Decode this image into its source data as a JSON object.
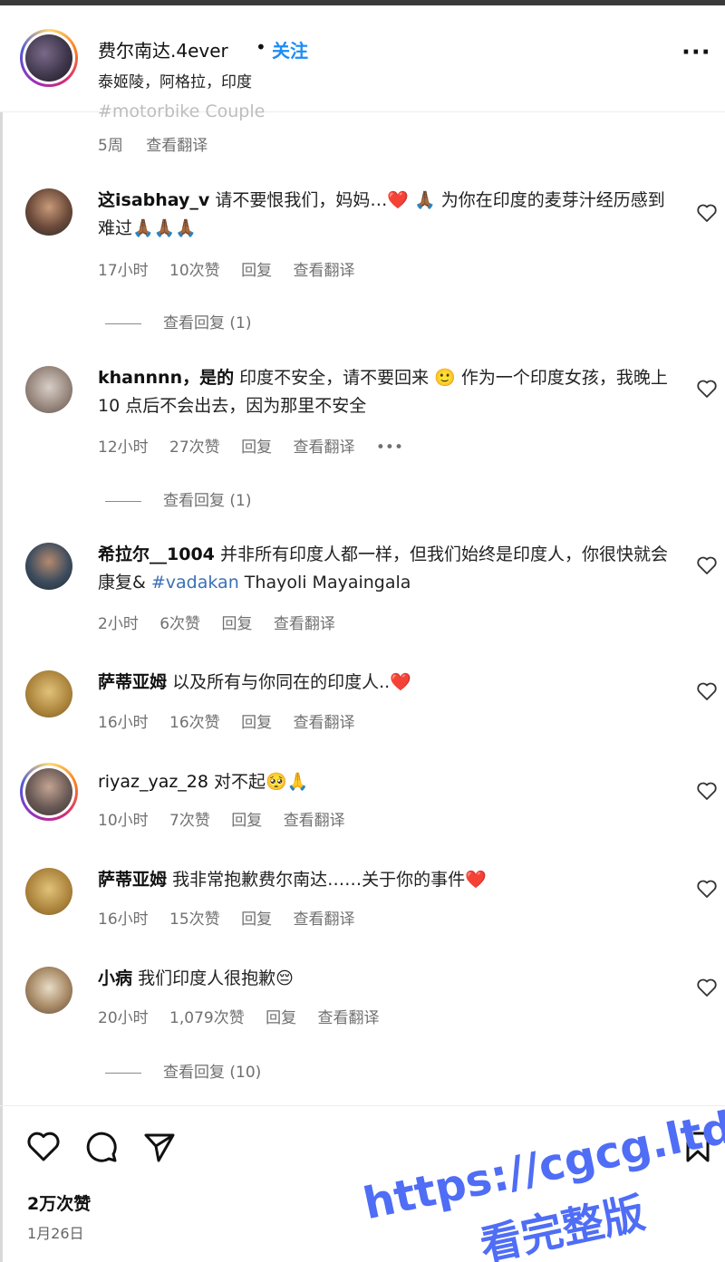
{
  "header": {
    "username": "费尔南达.4ever",
    "dot": "•",
    "follow_label": "关注",
    "location": "泰姬陵，阿格拉，印度",
    "more_icon": "more-icon"
  },
  "previous": {
    "hashtag": "#motorbike Couple",
    "time": "5周",
    "translate": "查看翻译"
  },
  "comments": [
    {
      "user": "这isabhay_v",
      "text": "请不要恨我们，妈妈…❤️ 🙏🏾 为你在印度的麦芽汁经历感到难过🙏🏾🙏🏾🙏🏾",
      "time": "17小时",
      "likes": "10次赞",
      "reply": "回复",
      "translate": "查看翻译",
      "view_replies": "查看回复 (1)"
    },
    {
      "user": "khannnn，是的",
      "text": "印度不安全，请不要回来 🙂 作为一个印度女孩，我晚上 10 点后不会出去，因为那里不安全",
      "time": "12小时",
      "likes": "27次赞",
      "reply": "回复",
      "translate": "查看翻译",
      "more": "•••",
      "view_replies": "查看回复 (1)"
    },
    {
      "user": "希拉尔__1004",
      "text": "并非所有印度人都一样，但我们始终是印度人，你很快就会康复&",
      "hashtag": "#vadakan",
      "text_after": "Thayoli Mayaingala",
      "time": "2小时",
      "likes": "6次赞",
      "reply": "回复",
      "translate": "查看翻译"
    },
    {
      "user": "萨蒂亚姆",
      "text": "以及所有与你同在的印度人..❤️",
      "time": "16小时",
      "likes": "16次赞",
      "reply": "回复",
      "translate": "查看翻译"
    },
    {
      "user": "riyaz_yaz_28",
      "text": "对不起🥺🙏",
      "time": "10小时",
      "likes": "7次赞",
      "reply": "回复",
      "translate": "查看翻译"
    },
    {
      "user": "萨蒂亚姆",
      "text": "我非常抱歉费尔南达……关于你的事件❤️",
      "time": "16小时",
      "likes": "15次赞",
      "reply": "回复",
      "translate": "查看翻译"
    },
    {
      "user": "小病",
      "text": "我们印度人很抱歉😔",
      "time": "20小时",
      "likes": "1,079次赞",
      "reply": "回复",
      "translate": "查看翻译",
      "view_replies": "查看回复 (10)"
    }
  ],
  "footer": {
    "likes": "2万次赞",
    "date": "1月26日",
    "icons": [
      "heart-icon",
      "comment-icon",
      "share-icon",
      "bookmark-icon"
    ]
  },
  "watermark": {
    "line1": "https://cgcg.ltd",
    "line2": "看完整版"
  },
  "colors": {
    "follow": "#1d8cf5",
    "hashtag": "#3b6fb6",
    "watermark": "#4f6df5"
  }
}
